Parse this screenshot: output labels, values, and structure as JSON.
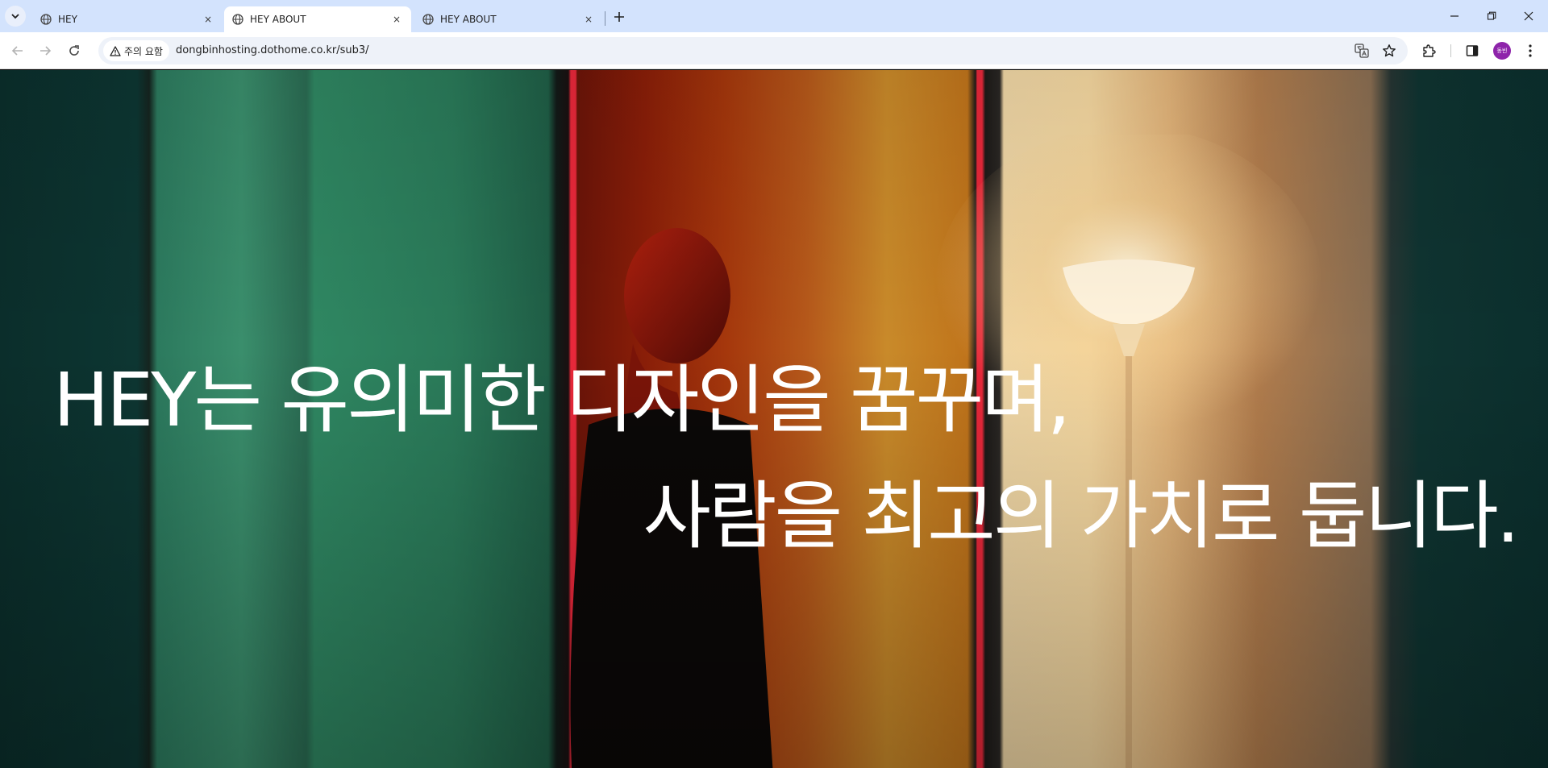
{
  "browser": {
    "tabs": [
      {
        "title": "HEY",
        "active": false
      },
      {
        "title": "HEY ABOUT",
        "active": true
      },
      {
        "title": "HEY ABOUT",
        "active": false
      }
    ],
    "new_tab_label": "+",
    "close_label": "×",
    "security_chip": "주의 요함",
    "url": "dongbinhosting.dothome.co.kr/sub3/",
    "profile_initials": "동빈",
    "colors": {
      "tabstrip": "#d3e3fd",
      "toolbar": "#ffffff",
      "omnibox": "#eef2f9",
      "avatar": "#8e24aa"
    }
  },
  "hero": {
    "line1": "HEY는 유의미한 디자인을 꿈꾸며,",
    "line2": "사람을 최고의 가치로 둡니다.",
    "text_color": "#ffffff",
    "icons": [
      "tab-search-icon",
      "globe-icon",
      "close-icon",
      "plus-icon",
      "minimize-icon",
      "restore-icon",
      "back-arrow-icon",
      "forward-arrow-icon",
      "reload-icon",
      "warning-icon",
      "translate-icon",
      "star-icon",
      "extensions-icon",
      "side-panel-icon",
      "more-icon"
    ]
  }
}
